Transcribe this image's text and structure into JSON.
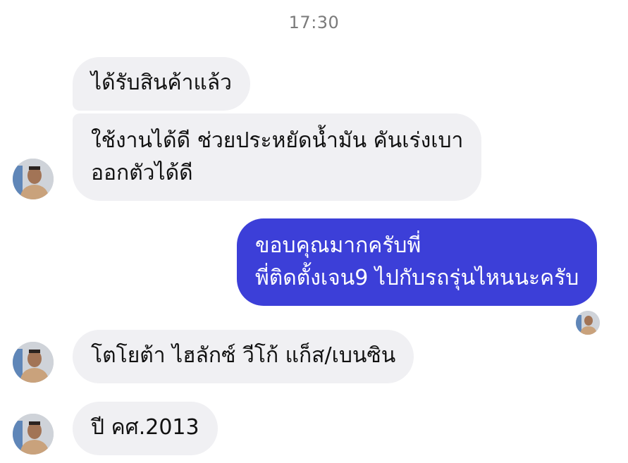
{
  "timestamp": "17:30",
  "messages": [
    {
      "id": "m1",
      "direction": "incoming",
      "lines": [
        "ได้รับสินค้าแล้ว"
      ]
    },
    {
      "id": "m2",
      "direction": "incoming",
      "lines": [
        "ใช้งานได้ดี ช่วยประหยัดน้ำมัน คันเร่งเบา",
        "ออกตัวได้ดี"
      ]
    },
    {
      "id": "m3",
      "direction": "outgoing",
      "lines": [
        "ขอบคุณมากครับพี่",
        "พี่ติดตั้งเจน9 ไปกับรถรุ่นไหนนะครับ"
      ]
    },
    {
      "id": "m4",
      "direction": "incoming",
      "lines": [
        "โตโยต้า ไฮลักซ์ วีโก้  แก็ส/เบนซิน"
      ]
    },
    {
      "id": "m5",
      "direction": "incoming",
      "lines": [
        "ปี คศ.2013"
      ]
    }
  ],
  "colors": {
    "incoming_bubble": "#f0f0f3",
    "outgoing_bubble": "#3c3fd8",
    "timestamp_text": "#7a7a7a"
  },
  "icons": {
    "contact_avatar": "contact-avatar-photo",
    "read_receipt": "read-receipt-avatar"
  }
}
